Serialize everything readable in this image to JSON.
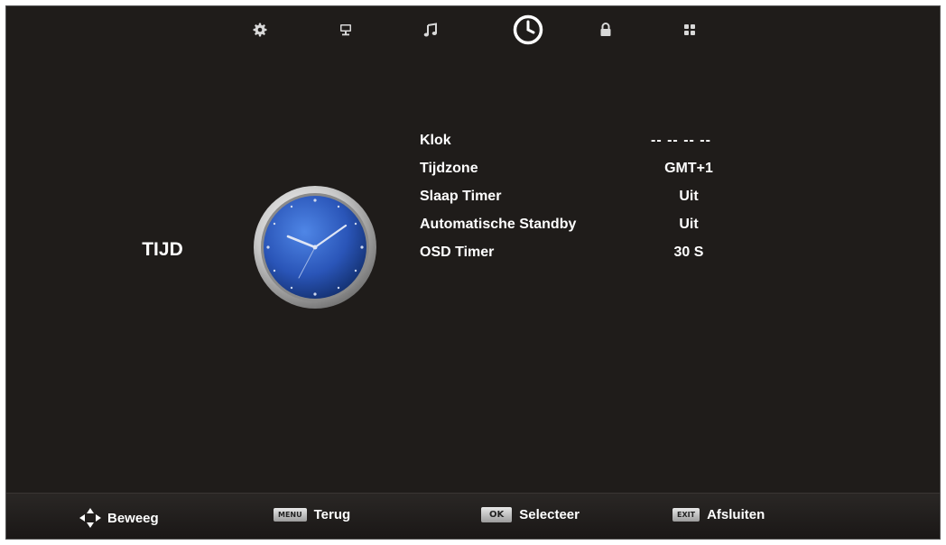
{
  "tabs": [
    {
      "name": "tab-picture",
      "icon": "gear-icon",
      "selected": false
    },
    {
      "name": "tab-screen",
      "icon": "monitor-icon",
      "selected": false
    },
    {
      "name": "tab-sound",
      "icon": "music-note-icon",
      "selected": false
    },
    {
      "name": "tab-time",
      "icon": "clock-icon",
      "selected": true
    },
    {
      "name": "tab-lock",
      "icon": "lock-icon",
      "selected": false
    },
    {
      "name": "tab-setup",
      "icon": "grid-icon",
      "selected": false
    }
  ],
  "section": {
    "title": "TIJD",
    "icon": "analog-clock-icon"
  },
  "menu": {
    "items": [
      {
        "label": "Klok",
        "value": "--  --    --  --"
      },
      {
        "label": "Tijdzone",
        "value": "GMT+1"
      },
      {
        "label": "Slaap Timer",
        "value": "Uit"
      },
      {
        "label": "Automatische Standby",
        "value": "Uit"
      },
      {
        "label": "OSD Timer",
        "value": "30 S"
      }
    ]
  },
  "footer": {
    "move_label": "Beweeg",
    "menu_key": "MENU",
    "back_label": "Terug",
    "ok_key": "OK",
    "select_label": "Selecteer",
    "exit_key": "EXIT",
    "exit_label": "Afsluiten"
  },
  "colors": {
    "background": "#1f1c1a",
    "text": "#ffffff",
    "clock_face": "#2a55b8"
  }
}
